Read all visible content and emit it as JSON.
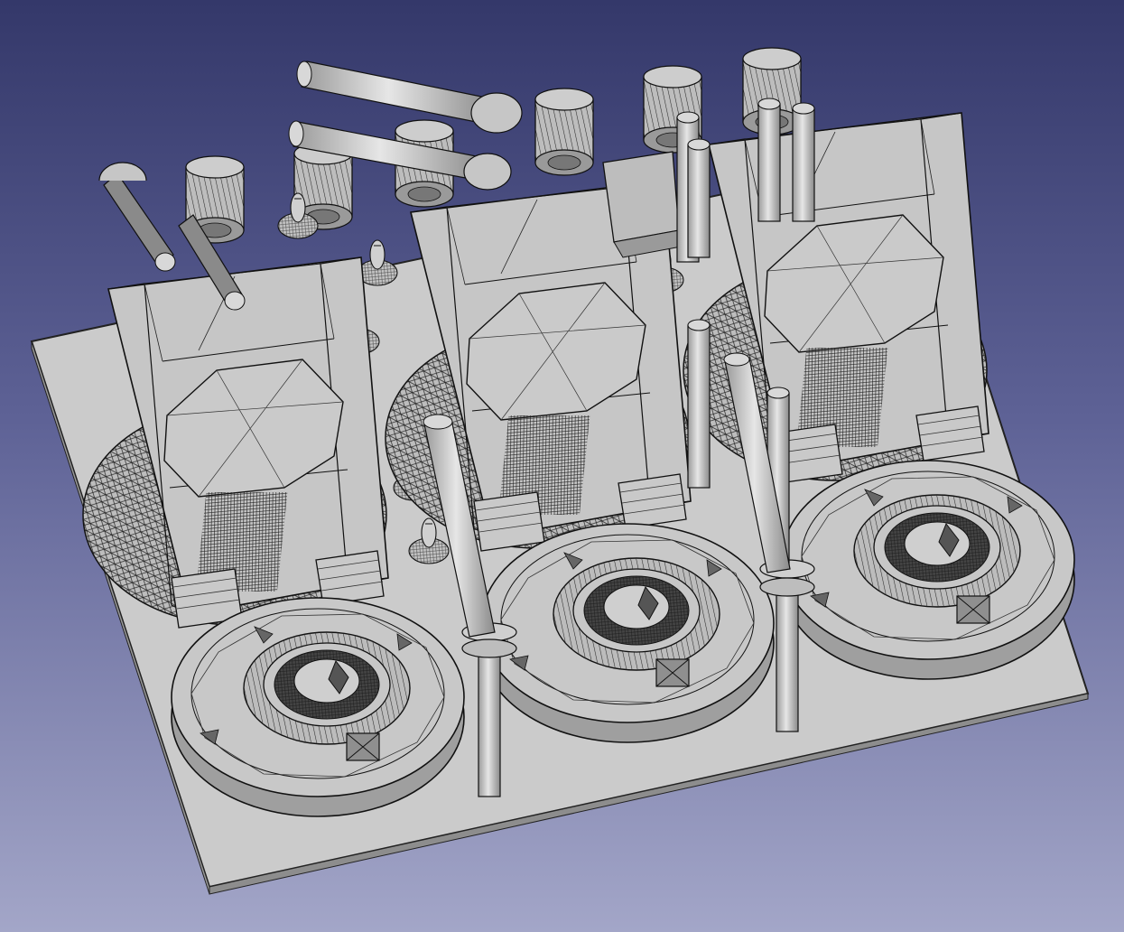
{
  "viewport": {
    "kind": "3d-mesh-view",
    "background": {
      "top": "#34386a",
      "bottom": "#a3a6c8"
    }
  },
  "scene": {
    "mesh_fill": "#c4c4c4",
    "mesh_shade": "#9d9d9d",
    "mesh_dark": "#6f6f6f",
    "edge_color": "#1a1a1a",
    "tank_count": 3,
    "turret_count": 3,
    "barrel_count": 7,
    "post_count": 8,
    "sprue_count": 6
  }
}
